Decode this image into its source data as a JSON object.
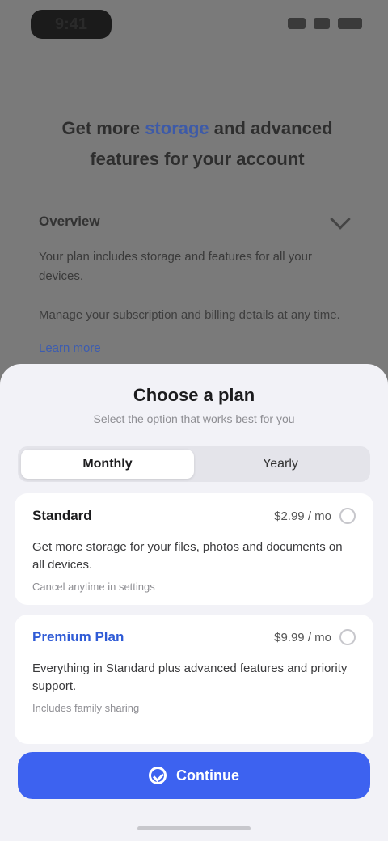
{
  "status_bar": {
    "time": "9:41",
    "icons": [
      "signal-icon",
      "wifi-icon",
      "battery-icon"
    ]
  },
  "background_page": {
    "headline_prefix": "Get more",
    "headline_accent": "storage",
    "headline_suffix": "and advanced features for your account",
    "row_label": "Overview",
    "paragraph": "Your plan includes storage and features for all your devices.",
    "paragraph2": "Manage your subscription and billing details at any time.",
    "link": "Learn more"
  },
  "sheet": {
    "title": "Choose a plan",
    "subtitle": "Select the option that works best for you",
    "segments": [
      {
        "label": "Monthly",
        "active": true
      },
      {
        "label": "Yearly",
        "active": false
      }
    ],
    "plans": [
      {
        "name": "Standard",
        "price": "$2.99 / mo",
        "description": "Get more storage for your files, photos and documents on all devices.",
        "note": "Cancel anytime in settings"
      },
      {
        "name": "Premium Plan",
        "price": "$9.99 / mo",
        "description": "Everything in Standard plus advanced features and priority support.",
        "note": "Includes family sharing"
      }
    ],
    "cta_label": "Continue"
  },
  "colors": {
    "accent": "#3d62f0",
    "sheet_bg": "#f2f2f7",
    "dim_bg": "#7a7a7a"
  }
}
